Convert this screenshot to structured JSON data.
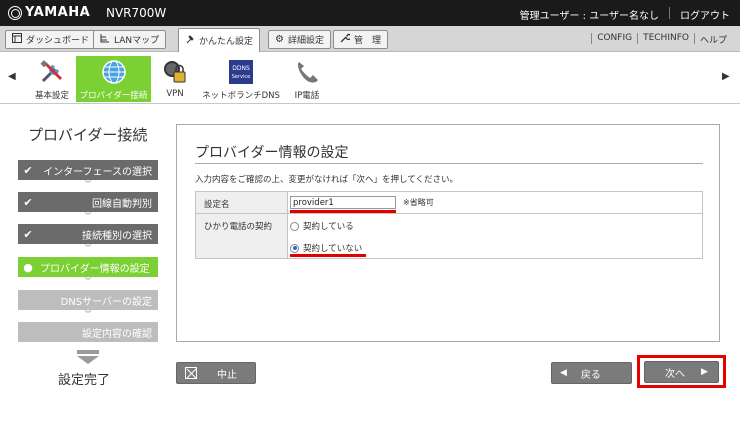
{
  "brand": "YAMAHA",
  "model": "NVR700W",
  "user": {
    "label": "管理ユーザー : ユーザー名なし",
    "logout": "ログアウト"
  },
  "tabs": [
    {
      "label": "ダッシュボード",
      "icon": "dashboard-icon"
    },
    {
      "label": "LANマップ",
      "icon": "lan-map-icon"
    },
    {
      "label": "かんたん設定",
      "icon": "easy-setup-icon",
      "active": true
    },
    {
      "label": "詳細設定",
      "icon": "gear-icon"
    },
    {
      "label": "管　理",
      "icon": "wrench-icon"
    }
  ],
  "toplinks": [
    "CONFIG",
    "TECHINFO",
    "ヘルプ"
  ],
  "setup_icons": [
    {
      "label": "基本設定",
      "icon": "tools-icon"
    },
    {
      "label": "プロバイダー接続",
      "icon": "globe-icon",
      "selected": true
    },
    {
      "label": "VPN",
      "icon": "vpn-lock-icon"
    },
    {
      "label": "ネットボランチDNS",
      "icon": "ddns-icon",
      "badge": "DDNS Service"
    },
    {
      "label": "IP電話",
      "icon": "phone-icon"
    }
  ],
  "wizard": {
    "title": "プロバイダー接続",
    "steps": [
      {
        "label": "インターフェースの選択",
        "state": "done"
      },
      {
        "label": "回線自動判別",
        "state": "done"
      },
      {
        "label": "接続種別の選択",
        "state": "done"
      },
      {
        "label": "プロバイダー情報の設定",
        "state": "current"
      },
      {
        "label": "DNSサーバーの設定",
        "state": "todo"
      },
      {
        "label": "設定内容の確認",
        "state": "todo"
      }
    ],
    "complete": "設定完了"
  },
  "panel": {
    "title": "プロバイダー情報の設定",
    "description": "入力内容をご確認の上、変更がなければ「次へ」を押してください。",
    "fields": {
      "name_label": "設定名",
      "name_value": "provider1",
      "name_note": "※省略可",
      "phone_label": "ひかり電話の契約",
      "phone_options": [
        "契約している",
        "契約していない"
      ],
      "phone_selected": 1
    }
  },
  "buttons": {
    "cancel": "中止",
    "back": "戻る",
    "next": "次へ"
  },
  "colors": {
    "accent": "#7bd034",
    "highlight": "#e60000",
    "button": "#7b7b7b"
  }
}
